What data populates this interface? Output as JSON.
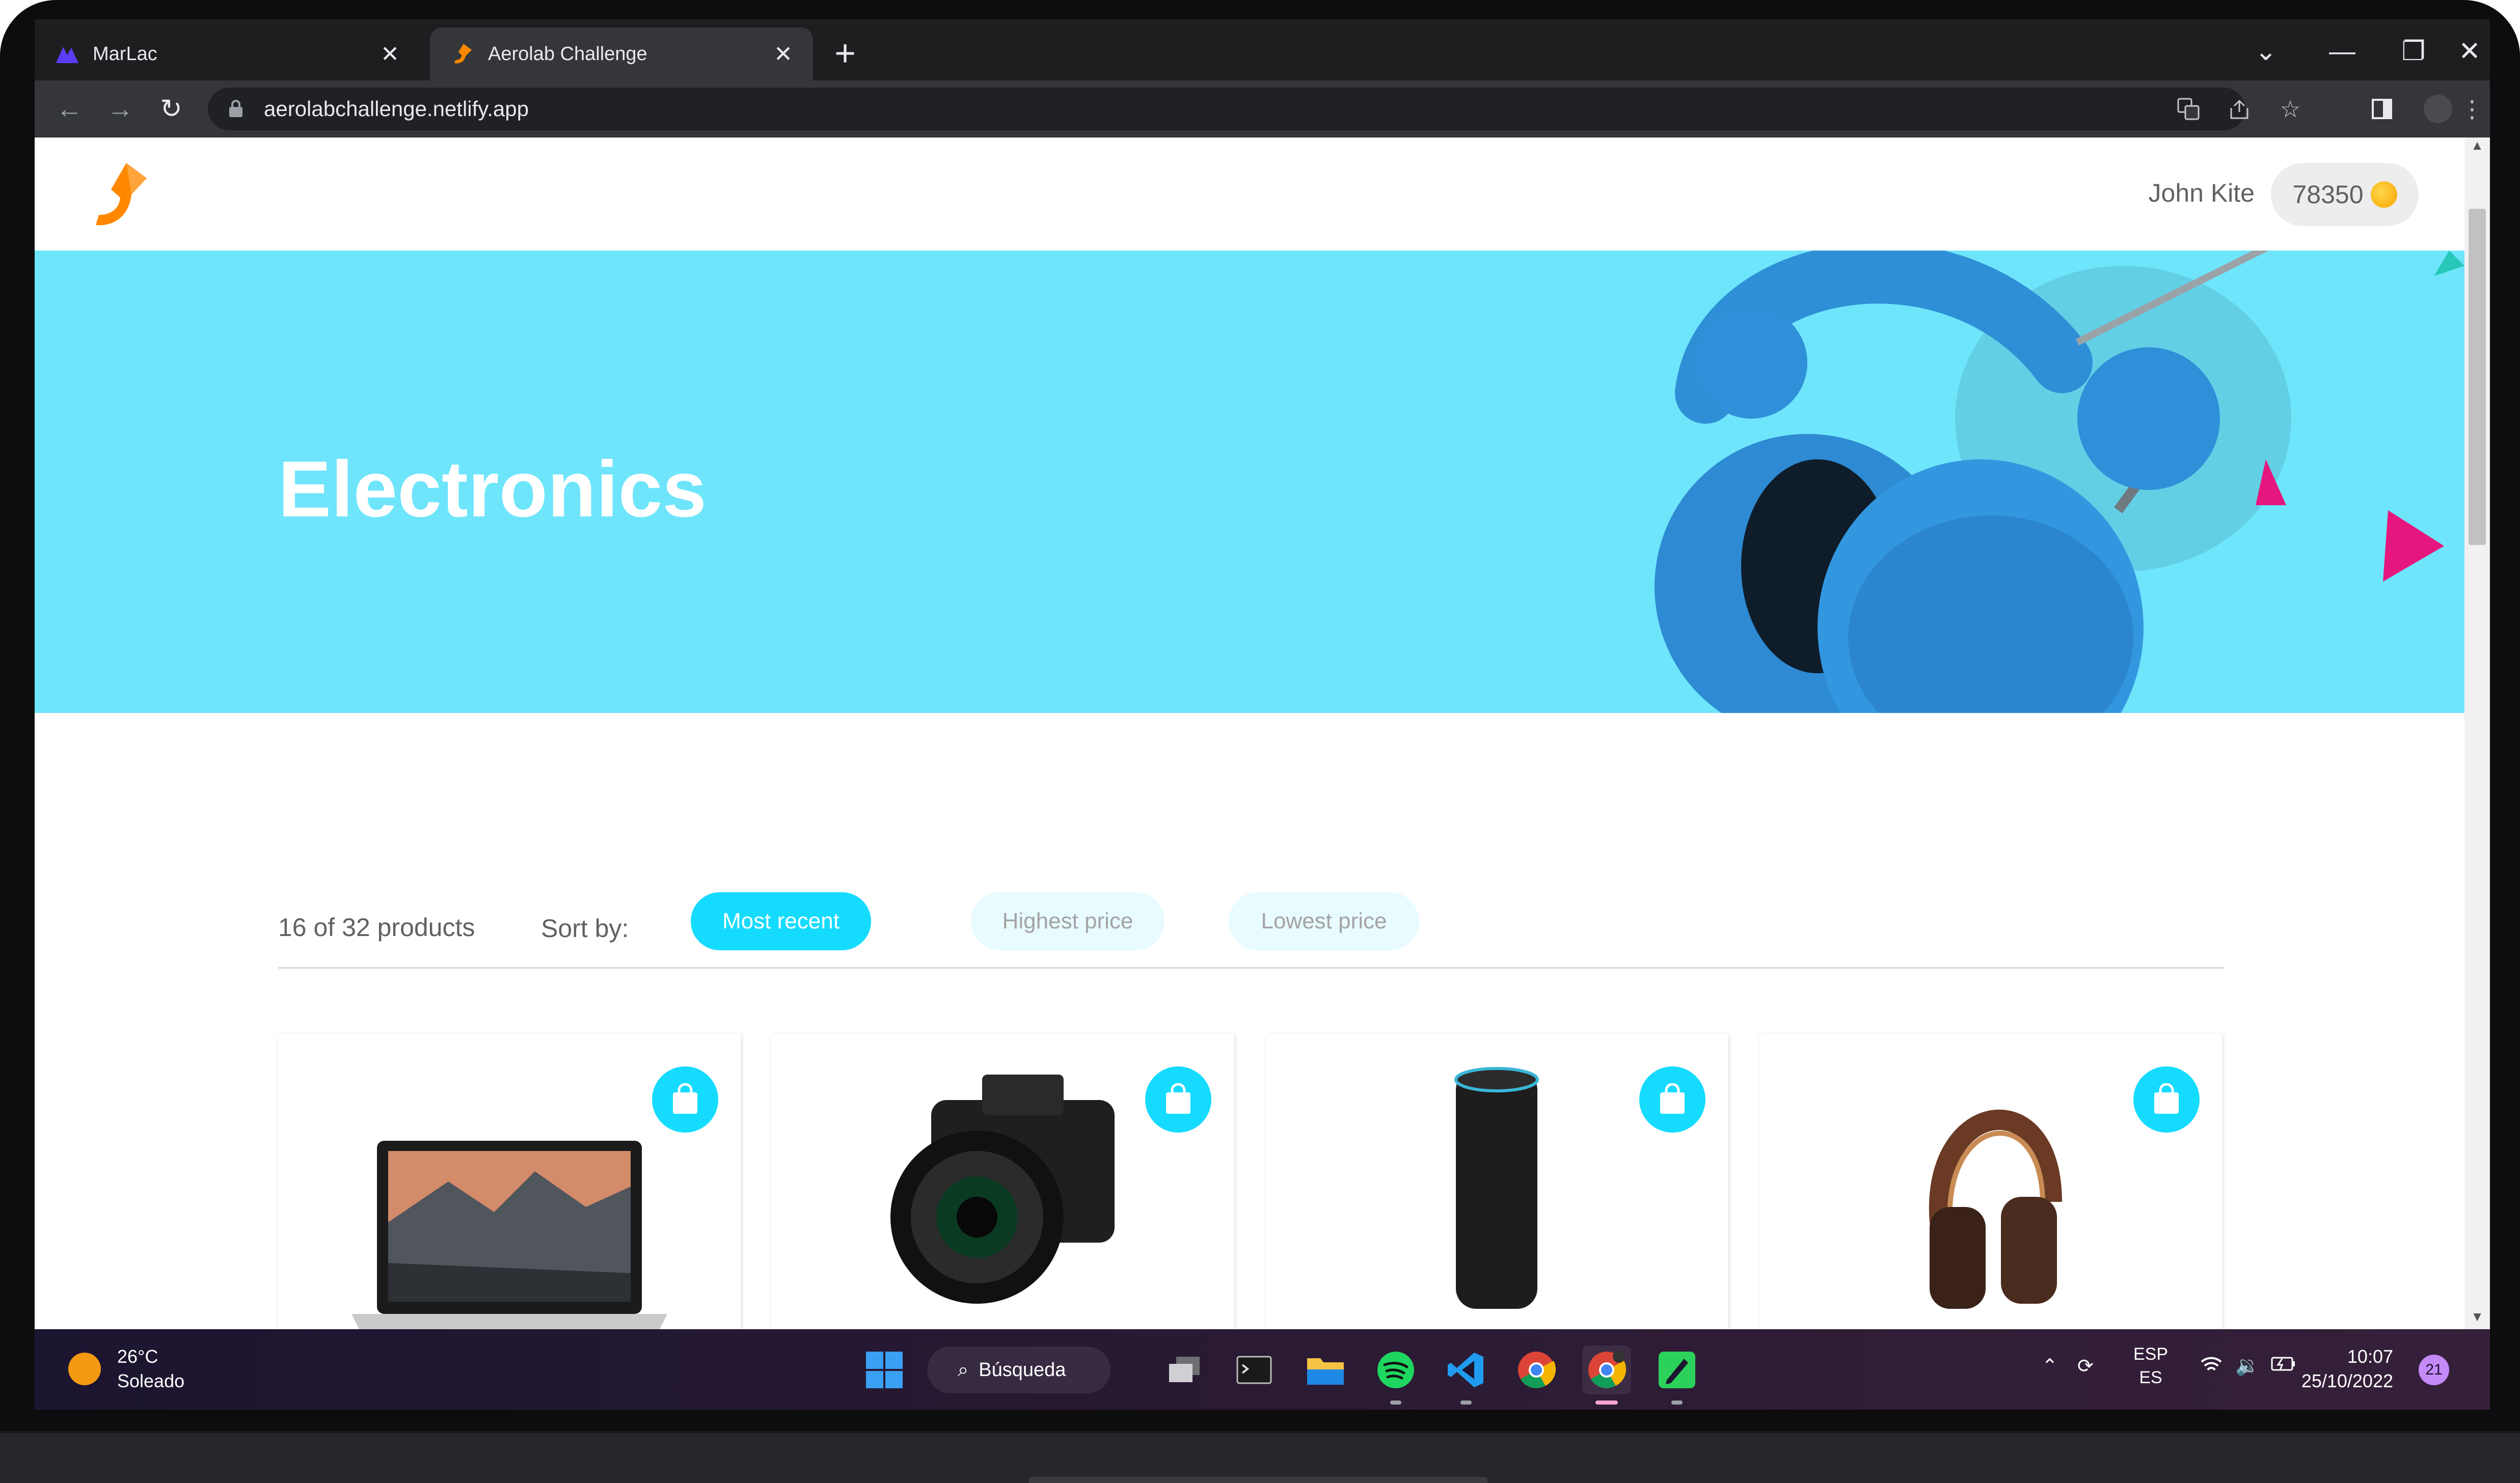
{
  "browser": {
    "tabs": [
      {
        "title": "MarLac",
        "active": false,
        "icon": "marlac-logo-icon"
      },
      {
        "title": "Aerolab Challenge",
        "active": true,
        "icon": "aerolab-logo-icon"
      }
    ],
    "new_tab_label": "+",
    "url": "aerolabchallenge.netlify.app"
  },
  "site": {
    "user": {
      "name": "John Kite",
      "points": "78350"
    },
    "hero": {
      "title": "Electronics"
    },
    "filters": {
      "count": "16 of 32 products",
      "sort_label": "Sort by:",
      "options": [
        "Most recent",
        "Highest price",
        "Lowest price"
      ],
      "selected": "Most recent"
    },
    "products": [
      {
        "image": "macbook-pro-laptop"
      },
      {
        "image": "canon-eos-camera"
      },
      {
        "image": "amazon-echo-speaker"
      },
      {
        "image": "marshall-headphones"
      }
    ],
    "colors": {
      "accent": "#15dbff",
      "hero_bg": "#6ee5fb",
      "logo": "#ff8800"
    }
  },
  "taskbar": {
    "weather": {
      "temp": "26°C",
      "condition": "Soleado"
    },
    "search_label": "Búsqueda",
    "language": {
      "top": "ESP",
      "bottom": "ES"
    },
    "time": "10:07",
    "date": "25/10/2022",
    "notifications": "21"
  }
}
